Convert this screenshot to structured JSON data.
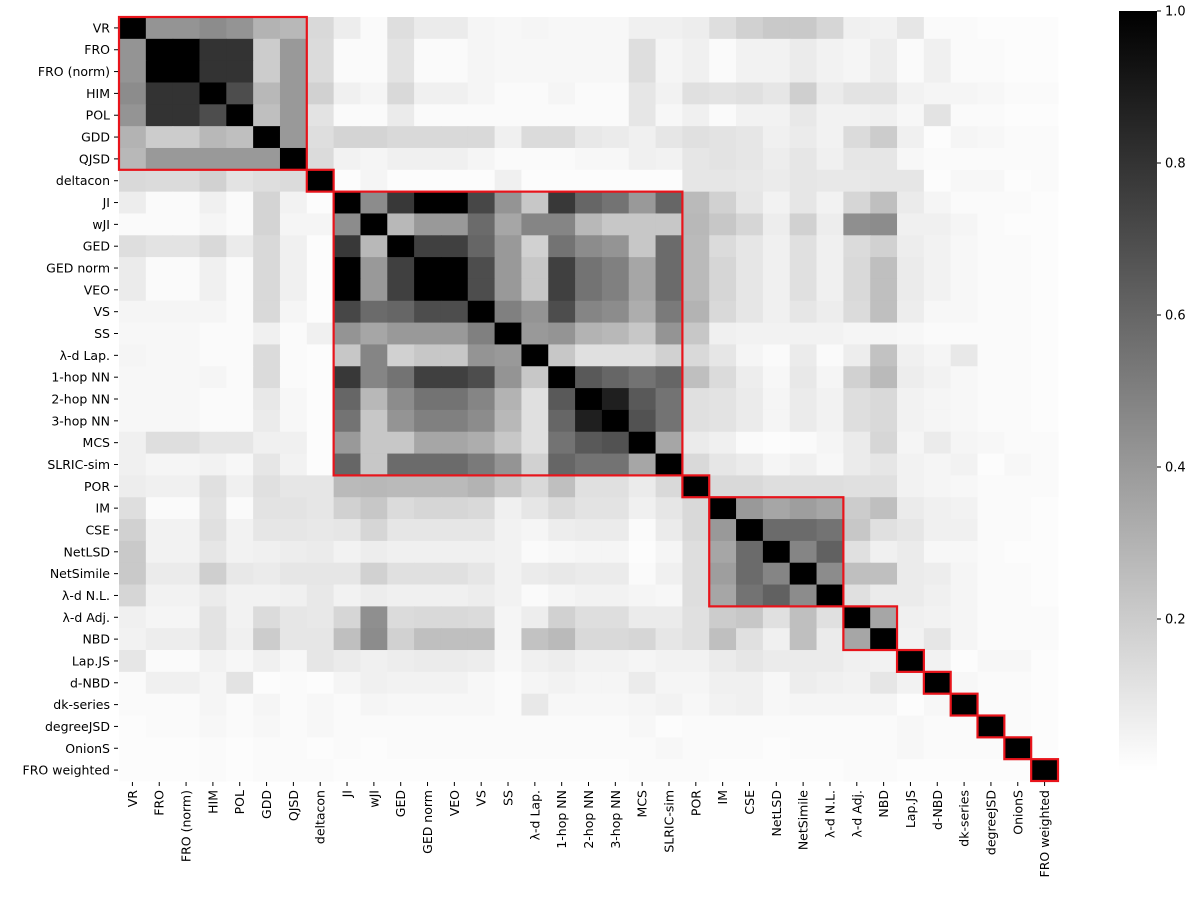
{
  "chart_data": {
    "type": "heatmap",
    "title": "",
    "xlabel": "",
    "ylabel": "",
    "colormap": "gray_r",
    "vmin": 0.0,
    "vmax": 1.0,
    "labels": [
      "VR",
      "FRO",
      "FRO (norm)",
      "HIM",
      "POL",
      "GDD",
      "QJSD",
      "deltacon",
      "JI",
      "wJI",
      "GED",
      "GED norm",
      "VEO",
      "VS",
      "SS",
      "λ-d Lap.",
      "1-hop NN",
      "2-hop NN",
      "3-hop NN",
      "MCS",
      "SLRIC-sim",
      "POR",
      "IM",
      "CSE",
      "NetLSD",
      "NetSimile",
      "λ-d N.L.",
      "λ-d Adj.",
      "NBD",
      "Lap.JS",
      "d-NBD",
      "dk-series",
      "degreeJSD",
      "OnionS",
      "FRO weighted"
    ],
    "colorbar": {
      "ticks": [
        0.2,
        0.4,
        0.6,
        0.8,
        1.0
      ],
      "tick_labels": [
        "0.2",
        "0.4",
        "0.6",
        "0.8",
        "1.0"
      ],
      "range": [
        0.0,
        1.0
      ]
    },
    "highlight_blocks": [
      {
        "start": "VR",
        "end": "QJSD"
      },
      {
        "start": "deltacon",
        "end": "deltacon"
      },
      {
        "start": "JI",
        "end": "SLRIC-sim"
      },
      {
        "start": "POR",
        "end": "POR"
      },
      {
        "start": "IM",
        "end": "λ-d N.L."
      },
      {
        "start": "λ-d Adj.",
        "end": "NBD"
      },
      {
        "start": "Lap.JS",
        "end": "Lap.JS"
      },
      {
        "start": "d-NBD",
        "end": "d-NBD"
      },
      {
        "start": "dk-series",
        "end": "dk-series"
      },
      {
        "start": "degreeJSD",
        "end": "degreeJSD"
      },
      {
        "start": "OnionS",
        "end": "OnionS"
      },
      {
        "start": "FRO weighted",
        "end": "FRO weighted"
      }
    ],
    "highlight_color": "#e8141b",
    "matrix": [
      [
        1.0,
        0.42,
        0.42,
        0.45,
        0.42,
        0.3,
        0.28,
        0.15,
        0.07,
        0.02,
        0.13,
        0.08,
        0.08,
        0.04,
        0.03,
        0.04,
        0.03,
        0.03,
        0.03,
        0.06,
        0.06,
        0.07,
        0.13,
        0.18,
        0.21,
        0.21,
        0.16,
        0.06,
        0.05,
        0.1,
        0.02,
        0.02,
        0.01,
        0.01,
        0.01
      ],
      [
        0.42,
        1.0,
        1.0,
        0.8,
        0.8,
        0.2,
        0.4,
        0.14,
        0.02,
        0.02,
        0.11,
        0.02,
        0.02,
        0.04,
        0.03,
        0.03,
        0.03,
        0.03,
        0.03,
        0.13,
        0.04,
        0.06,
        0.02,
        0.05,
        0.05,
        0.08,
        0.05,
        0.04,
        0.07,
        0.02,
        0.06,
        0.02,
        0.02,
        0.01,
        0.01
      ],
      [
        0.42,
        1.0,
        1.0,
        0.8,
        0.8,
        0.2,
        0.4,
        0.14,
        0.02,
        0.02,
        0.11,
        0.02,
        0.02,
        0.04,
        0.03,
        0.03,
        0.03,
        0.03,
        0.03,
        0.13,
        0.04,
        0.06,
        0.02,
        0.05,
        0.05,
        0.08,
        0.05,
        0.04,
        0.07,
        0.02,
        0.06,
        0.02,
        0.02,
        0.01,
        0.01
      ],
      [
        0.45,
        0.8,
        0.8,
        1.0,
        0.7,
        0.28,
        0.4,
        0.18,
        0.06,
        0.04,
        0.15,
        0.06,
        0.06,
        0.04,
        0.02,
        0.02,
        0.04,
        0.02,
        0.02,
        0.1,
        0.05,
        0.12,
        0.11,
        0.12,
        0.1,
        0.19,
        0.08,
        0.11,
        0.11,
        0.05,
        0.04,
        0.04,
        0.03,
        0.02,
        0.02
      ],
      [
        0.42,
        0.8,
        0.8,
        0.7,
        1.0,
        0.25,
        0.4,
        0.11,
        0.02,
        0.02,
        0.08,
        0.02,
        0.02,
        0.02,
        0.02,
        0.02,
        0.02,
        0.02,
        0.02,
        0.1,
        0.03,
        0.06,
        0.02,
        0.05,
        0.05,
        0.09,
        0.05,
        0.05,
        0.06,
        0.03,
        0.11,
        0.02,
        0.02,
        0.01,
        0.01
      ],
      [
        0.3,
        0.2,
        0.2,
        0.28,
        0.25,
        1.0,
        0.4,
        0.13,
        0.17,
        0.17,
        0.15,
        0.15,
        0.15,
        0.15,
        0.06,
        0.14,
        0.14,
        0.09,
        0.08,
        0.06,
        0.1,
        0.12,
        0.11,
        0.1,
        0.06,
        0.08,
        0.05,
        0.14,
        0.2,
        0.06,
        0.01,
        0.04,
        0.03,
        0.02,
        0.02
      ],
      [
        0.28,
        0.4,
        0.4,
        0.4,
        0.4,
        0.4,
        1.0,
        0.14,
        0.05,
        0.04,
        0.06,
        0.06,
        0.06,
        0.04,
        0.02,
        0.02,
        0.02,
        0.03,
        0.03,
        0.06,
        0.05,
        0.1,
        0.11,
        0.1,
        0.07,
        0.1,
        0.06,
        0.1,
        0.1,
        0.03,
        0.02,
        0.02,
        0.02,
        0.02,
        0.02
      ],
      [
        0.15,
        0.14,
        0.14,
        0.18,
        0.11,
        0.13,
        0.14,
        1.0,
        0.01,
        0.04,
        0.01,
        0.01,
        0.01,
        0.01,
        0.06,
        0.01,
        0.01,
        0.01,
        0.01,
        0.01,
        0.01,
        0.1,
        0.1,
        0.09,
        0.08,
        0.1,
        0.09,
        0.09,
        0.1,
        0.1,
        0.01,
        0.03,
        0.03,
        0.01,
        0.02
      ],
      [
        0.07,
        0.02,
        0.02,
        0.06,
        0.02,
        0.17,
        0.05,
        0.01,
        1.0,
        0.45,
        0.78,
        1.0,
        1.0,
        0.72,
        0.42,
        0.22,
        0.78,
        0.6,
        0.55,
        0.4,
        0.6,
        0.27,
        0.18,
        0.1,
        0.05,
        0.1,
        0.05,
        0.16,
        0.25,
        0.08,
        0.04,
        0.02,
        0.02,
        0.02,
        0.01
      ],
      [
        0.02,
        0.02,
        0.02,
        0.04,
        0.02,
        0.17,
        0.04,
        0.04,
        0.45,
        1.0,
        0.28,
        0.4,
        0.4,
        0.58,
        0.35,
        0.48,
        0.48,
        0.28,
        0.22,
        0.22,
        0.22,
        0.28,
        0.22,
        0.16,
        0.07,
        0.18,
        0.07,
        0.44,
        0.45,
        0.06,
        0.06,
        0.04,
        0.02,
        0.01,
        0.01
      ],
      [
        0.13,
        0.11,
        0.11,
        0.15,
        0.08,
        0.15,
        0.06,
        0.01,
        0.78,
        0.28,
        1.0,
        0.75,
        0.75,
        0.6,
        0.4,
        0.18,
        0.55,
        0.45,
        0.42,
        0.22,
        0.58,
        0.27,
        0.14,
        0.1,
        0.06,
        0.12,
        0.06,
        0.14,
        0.18,
        0.07,
        0.05,
        0.03,
        0.02,
        0.02,
        0.01
      ],
      [
        0.08,
        0.02,
        0.02,
        0.06,
        0.02,
        0.15,
        0.06,
        0.01,
        1.0,
        0.4,
        0.75,
        1.0,
        1.0,
        0.7,
        0.4,
        0.22,
        0.75,
        0.55,
        0.5,
        0.35,
        0.58,
        0.27,
        0.16,
        0.1,
        0.06,
        0.12,
        0.06,
        0.15,
        0.25,
        0.08,
        0.05,
        0.03,
        0.02,
        0.02,
        0.01
      ],
      [
        0.08,
        0.02,
        0.02,
        0.06,
        0.02,
        0.15,
        0.06,
        0.01,
        1.0,
        0.4,
        0.75,
        1.0,
        1.0,
        0.7,
        0.4,
        0.22,
        0.75,
        0.55,
        0.5,
        0.35,
        0.58,
        0.27,
        0.16,
        0.1,
        0.06,
        0.12,
        0.06,
        0.15,
        0.25,
        0.08,
        0.05,
        0.03,
        0.02,
        0.02,
        0.01
      ],
      [
        0.04,
        0.04,
        0.04,
        0.04,
        0.02,
        0.15,
        0.04,
        0.01,
        0.72,
        0.58,
        0.6,
        0.7,
        0.7,
        1.0,
        0.5,
        0.42,
        0.7,
        0.48,
        0.45,
        0.32,
        0.52,
        0.3,
        0.15,
        0.1,
        0.06,
        0.1,
        0.07,
        0.14,
        0.25,
        0.07,
        0.03,
        0.03,
        0.02,
        0.02,
        0.01
      ],
      [
        0.03,
        0.03,
        0.03,
        0.02,
        0.02,
        0.06,
        0.02,
        0.06,
        0.42,
        0.35,
        0.4,
        0.4,
        0.4,
        0.5,
        1.0,
        0.4,
        0.42,
        0.3,
        0.28,
        0.22,
        0.42,
        0.22,
        0.06,
        0.05,
        0.05,
        0.05,
        0.05,
        0.04,
        0.04,
        0.03,
        0.02,
        0.02,
        0.02,
        0.02,
        0.01
      ],
      [
        0.04,
        0.03,
        0.03,
        0.02,
        0.02,
        0.14,
        0.02,
        0.01,
        0.22,
        0.48,
        0.18,
        0.22,
        0.22,
        0.42,
        0.4,
        1.0,
        0.22,
        0.12,
        0.12,
        0.12,
        0.18,
        0.15,
        0.1,
        0.04,
        0.02,
        0.08,
        0.02,
        0.07,
        0.24,
        0.06,
        0.04,
        0.09,
        0.02,
        0.02,
        0.01
      ],
      [
        0.03,
        0.03,
        0.03,
        0.04,
        0.02,
        0.14,
        0.02,
        0.01,
        0.78,
        0.48,
        0.55,
        0.75,
        0.75,
        0.7,
        0.42,
        0.22,
        1.0,
        0.65,
        0.6,
        0.55,
        0.6,
        0.25,
        0.14,
        0.07,
        0.03,
        0.09,
        0.04,
        0.18,
        0.27,
        0.07,
        0.05,
        0.03,
        0.02,
        0.02,
        0.01
      ],
      [
        0.03,
        0.03,
        0.03,
        0.02,
        0.02,
        0.09,
        0.03,
        0.01,
        0.6,
        0.28,
        0.45,
        0.55,
        0.55,
        0.48,
        0.3,
        0.12,
        0.65,
        1.0,
        0.88,
        0.65,
        0.55,
        0.12,
        0.11,
        0.08,
        0.04,
        0.08,
        0.05,
        0.13,
        0.15,
        0.05,
        0.04,
        0.03,
        0.02,
        0.02,
        0.01
      ],
      [
        0.03,
        0.03,
        0.03,
        0.02,
        0.02,
        0.08,
        0.03,
        0.01,
        0.55,
        0.22,
        0.42,
        0.5,
        0.5,
        0.45,
        0.28,
        0.12,
        0.6,
        0.88,
        1.0,
        0.68,
        0.55,
        0.12,
        0.11,
        0.08,
        0.04,
        0.08,
        0.05,
        0.13,
        0.15,
        0.05,
        0.04,
        0.03,
        0.02,
        0.02,
        0.01
      ],
      [
        0.06,
        0.13,
        0.13,
        0.1,
        0.1,
        0.06,
        0.06,
        0.01,
        0.4,
        0.22,
        0.22,
        0.35,
        0.35,
        0.32,
        0.22,
        0.12,
        0.55,
        0.65,
        0.68,
        1.0,
        0.35,
        0.08,
        0.06,
        0.02,
        0.01,
        0.02,
        0.04,
        0.08,
        0.16,
        0.04,
        0.08,
        0.04,
        0.03,
        0.02,
        0.02
      ],
      [
        0.06,
        0.04,
        0.04,
        0.05,
        0.03,
        0.1,
        0.05,
        0.01,
        0.6,
        0.22,
        0.58,
        0.58,
        0.58,
        0.52,
        0.42,
        0.18,
        0.6,
        0.55,
        0.55,
        0.35,
        1.0,
        0.15,
        0.1,
        0.08,
        0.04,
        0.06,
        0.03,
        0.08,
        0.1,
        0.05,
        0.04,
        0.05,
        0.01,
        0.03,
        0.02
      ],
      [
        0.07,
        0.06,
        0.06,
        0.12,
        0.06,
        0.12,
        0.1,
        0.1,
        0.27,
        0.28,
        0.27,
        0.27,
        0.27,
        0.3,
        0.22,
        0.15,
        0.25,
        0.12,
        0.12,
        0.08,
        0.15,
        1.0,
        0.15,
        0.15,
        0.13,
        0.13,
        0.13,
        0.12,
        0.12,
        0.05,
        0.04,
        0.03,
        0.02,
        0.02,
        0.02
      ],
      [
        0.13,
        0.02,
        0.02,
        0.11,
        0.02,
        0.11,
        0.11,
        0.1,
        0.18,
        0.22,
        0.14,
        0.16,
        0.16,
        0.15,
        0.06,
        0.1,
        0.14,
        0.11,
        0.11,
        0.06,
        0.1,
        0.15,
        1.0,
        0.4,
        0.35,
        0.38,
        0.35,
        0.2,
        0.25,
        0.08,
        0.06,
        0.05,
        0.02,
        0.02,
        0.01
      ],
      [
        0.18,
        0.05,
        0.05,
        0.12,
        0.05,
        0.1,
        0.1,
        0.09,
        0.1,
        0.16,
        0.1,
        0.1,
        0.1,
        0.1,
        0.05,
        0.04,
        0.07,
        0.08,
        0.08,
        0.02,
        0.08,
        0.15,
        0.4,
        1.0,
        0.58,
        0.58,
        0.55,
        0.22,
        0.12,
        0.1,
        0.06,
        0.06,
        0.02,
        0.02,
        0.01
      ],
      [
        0.21,
        0.05,
        0.05,
        0.1,
        0.05,
        0.06,
        0.07,
        0.08,
        0.05,
        0.07,
        0.06,
        0.06,
        0.06,
        0.06,
        0.05,
        0.02,
        0.03,
        0.04,
        0.04,
        0.01,
        0.04,
        0.13,
        0.35,
        0.58,
        1.0,
        0.48,
        0.62,
        0.12,
        0.06,
        0.08,
        0.03,
        0.03,
        0.02,
        0.01,
        0.01
      ],
      [
        0.21,
        0.08,
        0.08,
        0.19,
        0.09,
        0.08,
        0.1,
        0.1,
        0.1,
        0.18,
        0.12,
        0.12,
        0.12,
        0.1,
        0.05,
        0.08,
        0.09,
        0.08,
        0.08,
        0.02,
        0.06,
        0.13,
        0.38,
        0.58,
        0.48,
        1.0,
        0.45,
        0.25,
        0.25,
        0.08,
        0.07,
        0.04,
        0.02,
        0.02,
        0.01
      ],
      [
        0.16,
        0.05,
        0.05,
        0.08,
        0.05,
        0.05,
        0.06,
        0.09,
        0.05,
        0.07,
        0.06,
        0.06,
        0.06,
        0.07,
        0.05,
        0.02,
        0.04,
        0.05,
        0.05,
        0.04,
        0.03,
        0.13,
        0.35,
        0.55,
        0.62,
        0.45,
        1.0,
        0.12,
        0.08,
        0.08,
        0.06,
        0.04,
        0.02,
        0.02,
        0.01
      ],
      [
        0.06,
        0.04,
        0.04,
        0.11,
        0.05,
        0.14,
        0.1,
        0.09,
        0.16,
        0.44,
        0.14,
        0.15,
        0.15,
        0.14,
        0.04,
        0.07,
        0.18,
        0.13,
        0.13,
        0.08,
        0.08,
        0.12,
        0.2,
        0.22,
        0.12,
        0.25,
        0.12,
        1.0,
        0.35,
        0.06,
        0.05,
        0.04,
        0.02,
        0.02,
        0.02
      ],
      [
        0.05,
        0.07,
        0.07,
        0.11,
        0.06,
        0.2,
        0.1,
        0.1,
        0.25,
        0.45,
        0.18,
        0.25,
        0.25,
        0.25,
        0.04,
        0.24,
        0.27,
        0.15,
        0.15,
        0.16,
        0.1,
        0.12,
        0.25,
        0.12,
        0.06,
        0.25,
        0.08,
        0.35,
        1.0,
        0.05,
        0.1,
        0.04,
        0.02,
        0.02,
        0.02
      ],
      [
        0.1,
        0.02,
        0.02,
        0.05,
        0.03,
        0.06,
        0.03,
        0.1,
        0.08,
        0.06,
        0.07,
        0.08,
        0.08,
        0.07,
        0.03,
        0.06,
        0.07,
        0.05,
        0.05,
        0.04,
        0.05,
        0.05,
        0.08,
        0.1,
        0.08,
        0.08,
        0.08,
        0.06,
        0.05,
        1.0,
        0.05,
        0.01,
        0.03,
        0.03,
        0.01
      ],
      [
        0.02,
        0.06,
        0.06,
        0.04,
        0.11,
        0.01,
        0.02,
        0.01,
        0.04,
        0.06,
        0.05,
        0.05,
        0.05,
        0.03,
        0.02,
        0.04,
        0.05,
        0.04,
        0.04,
        0.08,
        0.04,
        0.04,
        0.06,
        0.06,
        0.03,
        0.07,
        0.06,
        0.05,
        0.1,
        0.05,
        1.0,
        0.03,
        0.02,
        0.02,
        0.01
      ],
      [
        0.02,
        0.02,
        0.02,
        0.04,
        0.02,
        0.04,
        0.02,
        0.03,
        0.02,
        0.04,
        0.03,
        0.03,
        0.03,
        0.03,
        0.02,
        0.09,
        0.03,
        0.03,
        0.03,
        0.04,
        0.05,
        0.03,
        0.05,
        0.06,
        0.03,
        0.04,
        0.04,
        0.04,
        0.04,
        0.01,
        0.03,
        1.0,
        0.02,
        0.02,
        0.01
      ],
      [
        0.01,
        0.02,
        0.02,
        0.03,
        0.02,
        0.03,
        0.02,
        0.03,
        0.02,
        0.02,
        0.02,
        0.02,
        0.02,
        0.02,
        0.02,
        0.02,
        0.02,
        0.02,
        0.02,
        0.03,
        0.01,
        0.02,
        0.02,
        0.02,
        0.02,
        0.02,
        0.02,
        0.02,
        0.02,
        0.03,
        0.02,
        0.02,
        1.0,
        0.02,
        0.01
      ],
      [
        0.01,
        0.01,
        0.01,
        0.02,
        0.01,
        0.02,
        0.02,
        0.01,
        0.02,
        0.01,
        0.02,
        0.02,
        0.02,
        0.02,
        0.02,
        0.02,
        0.02,
        0.02,
        0.02,
        0.02,
        0.03,
        0.02,
        0.02,
        0.02,
        0.01,
        0.02,
        0.02,
        0.02,
        0.02,
        0.03,
        0.02,
        0.02,
        0.02,
        1.0,
        0.01
      ],
      [
        0.01,
        0.01,
        0.01,
        0.02,
        0.01,
        0.02,
        0.02,
        0.02,
        0.01,
        0.01,
        0.01,
        0.01,
        0.01,
        0.01,
        0.01,
        0.01,
        0.01,
        0.01,
        0.01,
        0.02,
        0.02,
        0.02,
        0.01,
        0.01,
        0.01,
        0.01,
        0.01,
        0.02,
        0.02,
        0.01,
        0.01,
        0.01,
        0.01,
        0.01,
        1.0
      ]
    ]
  }
}
